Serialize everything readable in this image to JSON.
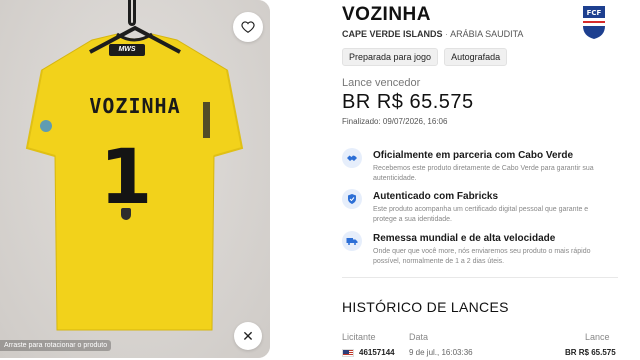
{
  "product": {
    "title": "VOZINHA",
    "team": "CAPE VERDE ISLANDS",
    "separator": "·",
    "opponent": "ARÁBIA SAUDITA",
    "crest_label": "FCF",
    "tags": [
      "Preparada para jogo",
      "Autografada"
    ]
  },
  "jersey": {
    "name": "VOZINHA",
    "number": "1",
    "sponsor": "MWS",
    "color": "#f2d21b"
  },
  "image_panel": {
    "rotate_hint": "Arraste para rotacionar o produto"
  },
  "bid": {
    "label": "Lance vencedor",
    "value": "BR R$ 65.575",
    "finalized": "Finalizado: 09/07/2026, 16:06"
  },
  "features": [
    {
      "icon": "handshake-icon",
      "title": "Oficialmente em parceria com Cabo Verde",
      "desc": "Recebemos este produto diretamente de Cabo Verde para garantir sua autenticidade."
    },
    {
      "icon": "shield-check-icon",
      "title": "Autenticado com Fabricks",
      "desc": "Este produto acompanha um certificado digital pessoal que garante e protege a sua identidade."
    },
    {
      "icon": "truck-icon",
      "title": "Remessa mundial e de alta velocidade",
      "desc": "Onde quer que você more, nós enviaremos seu produto o mais rápido possível, normalmente de 1 a 2 dias úteis."
    }
  ],
  "history": {
    "title": "HISTÓRICO DE LANCES",
    "columns": [
      "Licitante",
      "Data",
      "Lance"
    ],
    "rows": [
      {
        "bidder": "46157144",
        "date": "9 de jul., 16:03:36",
        "amount": "BR R$ 65.575"
      }
    ]
  },
  "colors": {
    "accent": "#2d6fd6",
    "icon_bg": "#e6eefb"
  }
}
